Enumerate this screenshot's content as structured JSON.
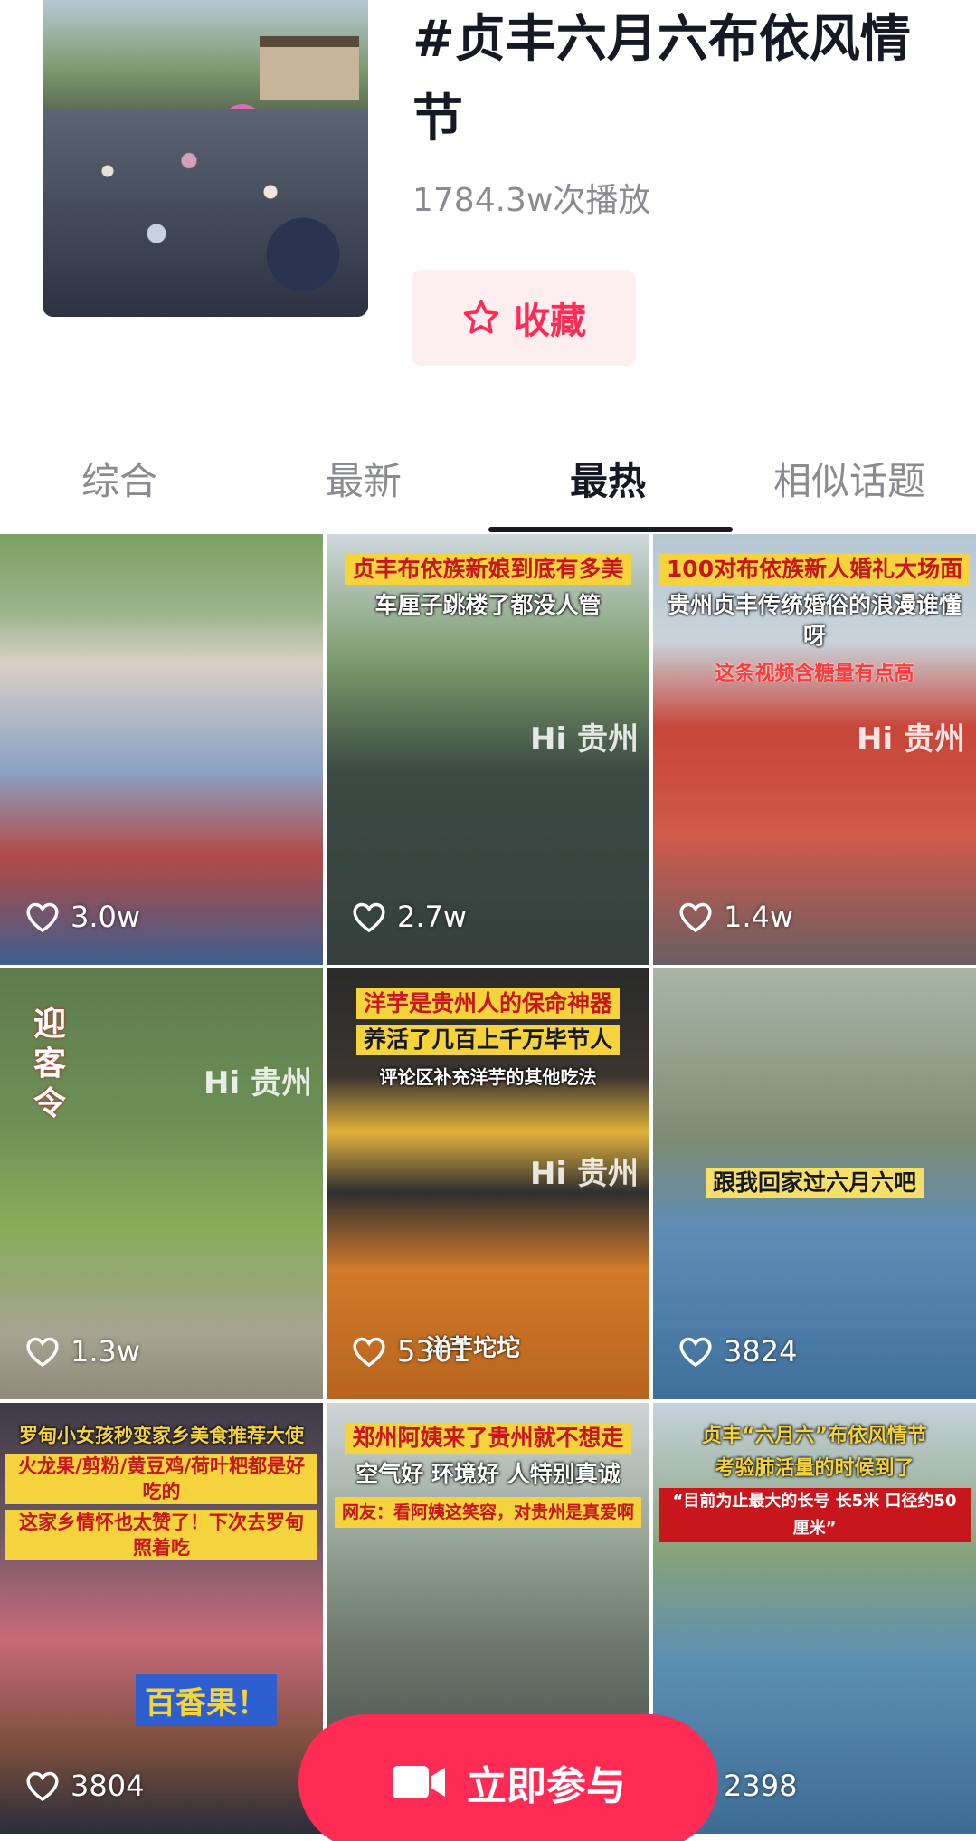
{
  "topic": {
    "title": "#贞丰六月六布依风情节",
    "play_count": "1784.3w次播放",
    "favorite_label": "收藏"
  },
  "tabs": [
    {
      "label": "综合",
      "active": false
    },
    {
      "label": "最新",
      "active": false
    },
    {
      "label": "最热",
      "active": true
    },
    {
      "label": "相似话题",
      "active": false
    }
  ],
  "videos": [
    {
      "likes": "3.0w",
      "captions": []
    },
    {
      "likes": "2.7w",
      "captions": [
        "贞丰布依族新娘到底有多美",
        "车厘子跳楼了都没人管"
      ],
      "watermark": "Hi 贵州"
    },
    {
      "likes": "1.4w",
      "captions": [
        "100对布依族新人婚礼大场面",
        "贵州贞丰传统婚俗的浪漫谁懂呀",
        "这条视频含糖量有点高"
      ],
      "watermark": "Hi 贵州"
    },
    {
      "likes": "1.3w",
      "captions": [
        "迎客令"
      ],
      "watermark": "Hi 贵州"
    },
    {
      "likes": "5301",
      "captions": [
        "洋芋是贵州人的保命神器",
        "养活了几百上千万毕节人",
        "评论区补充洋芋的其他吃法"
      ],
      "overlay_text": "洋芋坨坨",
      "watermark": "Hi 贵州"
    },
    {
      "likes": "3824",
      "captions": [
        "跟我回家过六月六吧"
      ]
    },
    {
      "likes": "3804",
      "captions": [
        "罗甸小女孩秒变家乡美食推荐大使",
        "火龙果/剪粉/黄豆鸡/荷叶粑都是好吃的",
        "这家乡情怀也太赞了！下次去罗甸照着吃"
      ],
      "overlay_text": "百香果！"
    },
    {
      "likes": "",
      "captions": [
        "郑州阿姨来了贵州就不想走",
        "空气好 环境好 人特别真诚",
        "网友：看阿姨这笑容，对贵州是真爱啊"
      ]
    },
    {
      "likes": "2398",
      "captions": [
        "贞丰“六月六”布依风情节",
        "考验肺活量的时候到了",
        "“目前为止最大的长号 长5米 口径约50厘米”"
      ]
    }
  ],
  "cta": {
    "label": "立即参与"
  },
  "colors": {
    "accent": "#fe2c55",
    "text_primary": "#161823",
    "text_secondary": "#8a8b91"
  }
}
